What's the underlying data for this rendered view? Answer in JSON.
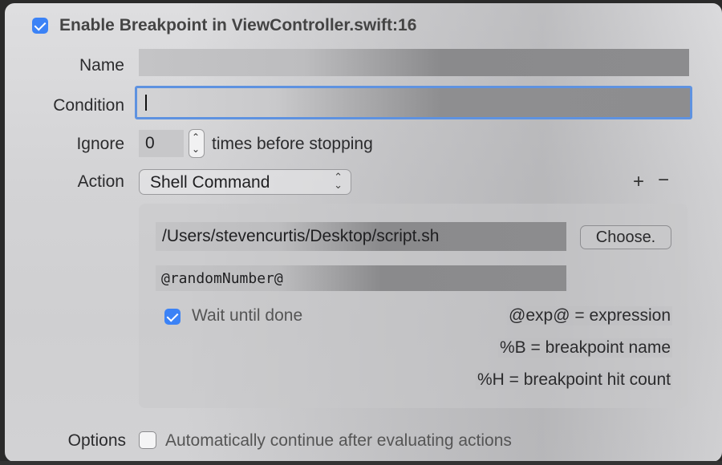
{
  "enable": {
    "checked": true,
    "label": "Enable Breakpoint in ViewController.swift:16"
  },
  "name": {
    "label": "Name",
    "value": ""
  },
  "condition": {
    "label": "Condition",
    "value": ""
  },
  "ignore": {
    "label": "Ignore",
    "value": "0",
    "suffix": "times before stopping"
  },
  "action": {
    "label": "Action",
    "selected": "Shell Command",
    "add_label": "+",
    "remove_label": "−",
    "command_path": "/Users/stevencurtis/Desktop/script.sh",
    "choose_label": "Choose.",
    "arguments": "@randomNumber@",
    "wait": {
      "checked": true,
      "label": "Wait until done"
    },
    "hints": [
      "@exp@ = expression",
      "%B = breakpoint name",
      "%H = breakpoint hit count"
    ]
  },
  "options": {
    "label": "Options",
    "checked": false,
    "text": "Automatically continue after evaluating actions"
  },
  "colors": {
    "accent": "#3b82f6",
    "focus_ring": "#5e92e0"
  }
}
